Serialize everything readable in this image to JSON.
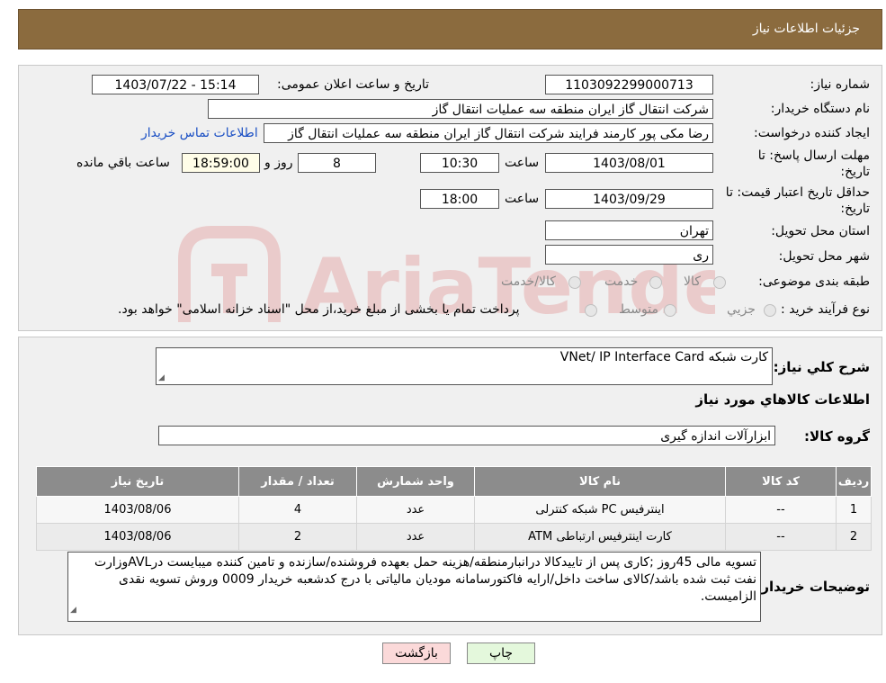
{
  "header": {
    "title": "جزئیات اطلاعات نیاز"
  },
  "form": {
    "need_number_label": "شماره نیاز:",
    "need_number": "1103092299000713",
    "announce_label": "تاریخ و ساعت اعلان عمومی:",
    "announce_value": "1403/07/22 - 15:14",
    "buyer_org_label": "نام دستگاه خریدار:",
    "buyer_org": "شرکت انتقال گاز ایران منطقه سه عملیات انتقال گاز",
    "creator_label": "ایجاد کننده درخواست:",
    "creator": "رضا مکی پور کارمند فرایند شرکت انتقال گاز ایران منطقه سه عملیات انتقال گاز",
    "contact_link": "اطلاعات تماس خریدار",
    "deadline_label_1": "مهلت ارسال پاسخ: تا",
    "deadline_label_2": "تاریخ:",
    "deadline_date": "1403/08/01",
    "time_label": "ساعت",
    "deadline_time": "10:30",
    "days_value": "8",
    "days_label": "روز و",
    "remaining_time": "18:59:00",
    "remaining_label": "ساعت باقي مانده",
    "price_label_1": "حداقل تاریخ اعتبار قیمت: تا",
    "price_label_2": "تاریخ:",
    "price_date": "1403/09/29",
    "price_time_label": "ساعت",
    "price_time": "18:00",
    "province_label": "استان محل تحویل:",
    "province": "تهران",
    "city_label": "شهر محل تحویل:",
    "city": "ری",
    "category_label": "طبقه بندی موضوعی:",
    "category_options": [
      "کالا",
      "خدمت",
      "کالا/خدمت"
    ],
    "process_label": "نوع فرآیند خرید :",
    "process_options": [
      "جزیي",
      "متوسط"
    ],
    "process_note": "پرداخت تمام یا بخشی از مبلغ خرید،از محل \"اسناد خزانه اسلامی\" خواهد بود."
  },
  "details": {
    "summary_label": "شرح کلي نیاز:",
    "summary": "کارت شبکه VNet/ IP Interface Card",
    "goods_title": "اطلاعات کالاهاي مورد نیاز",
    "group_label": "گروه کالا:",
    "group": "ابزارآلات اندازه گیری",
    "table_headers": [
      "ردیف",
      "کد کالا",
      "نام کالا",
      "واحد شمارش",
      "تعداد / مقدار",
      "تاریخ نیاز"
    ],
    "rows": [
      [
        "1",
        "--",
        "اینترفیس PC شبکه کنترلی",
        "عدد",
        "4",
        "1403/08/06"
      ],
      [
        "2",
        "--",
        "کارت اینترفیس ارتباطی ATM",
        "عدد",
        "2",
        "1403/08/06"
      ]
    ],
    "buyer_notes_label": "توضیحات خریدار:",
    "buyer_notes": "تسویه مالی 45روز ;کاری پس از تاییدکالا درانبارمنطقه/هزینه حمل بعهده فروشنده/سازنده و تامین کننده میبایست درAVLوزارت نفت ثبت شده باشد/کالای ساخت داخل/ارایه فاکتورسامانه مودیان مالیاتی با درج کدشعبه خریدار 0009 وروش تسویه نقدی الزامیست."
  },
  "buttons": {
    "print": "چاپ",
    "back": "بازگشت"
  },
  "watermark": {
    "text": "AriaTender.neT"
  },
  "colors": {
    "header": "#8b6b3e",
    "link": "#1a4fc4",
    "back_button": "#fbd9d9",
    "print_button": "#e4f8dc",
    "table_header": "#8c8c8c"
  }
}
